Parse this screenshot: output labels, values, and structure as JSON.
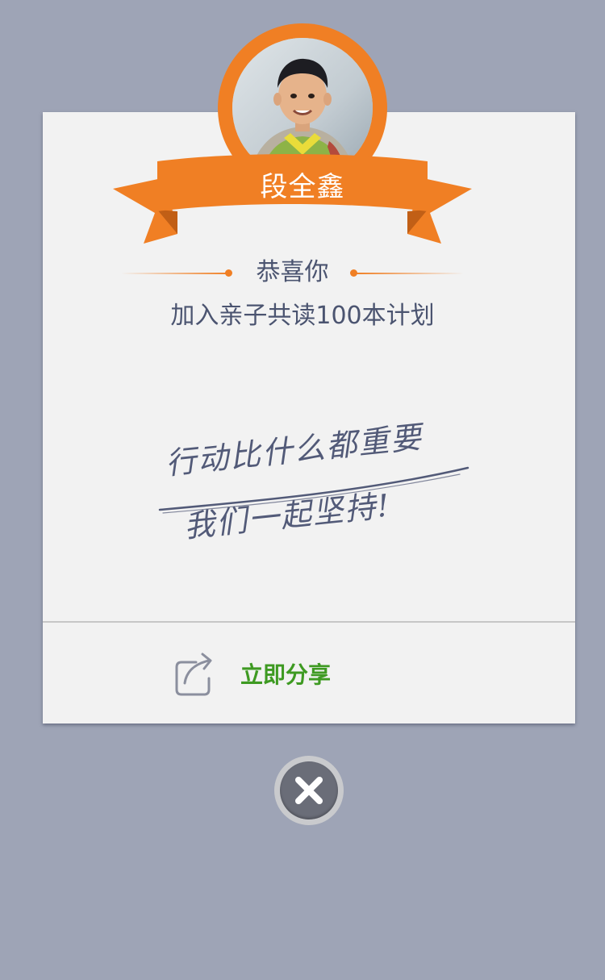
{
  "profile": {
    "name": "段全鑫",
    "avatar_icon": "child-portrait-photo"
  },
  "message": {
    "congrats": "恭喜你",
    "subtitle": "加入亲子共读100本计划",
    "handwritten_line1": "行动比什么都重要",
    "handwritten_line2": "我们一起坚持!"
  },
  "actions": {
    "share_label": "立即分享",
    "share_icon": "share-icon",
    "close_icon": "close-icon"
  },
  "colors": {
    "accent_orange": "#f07f24",
    "share_green": "#3e9a22",
    "text_slate": "#4b5470",
    "backdrop": "#9ea4b6"
  }
}
